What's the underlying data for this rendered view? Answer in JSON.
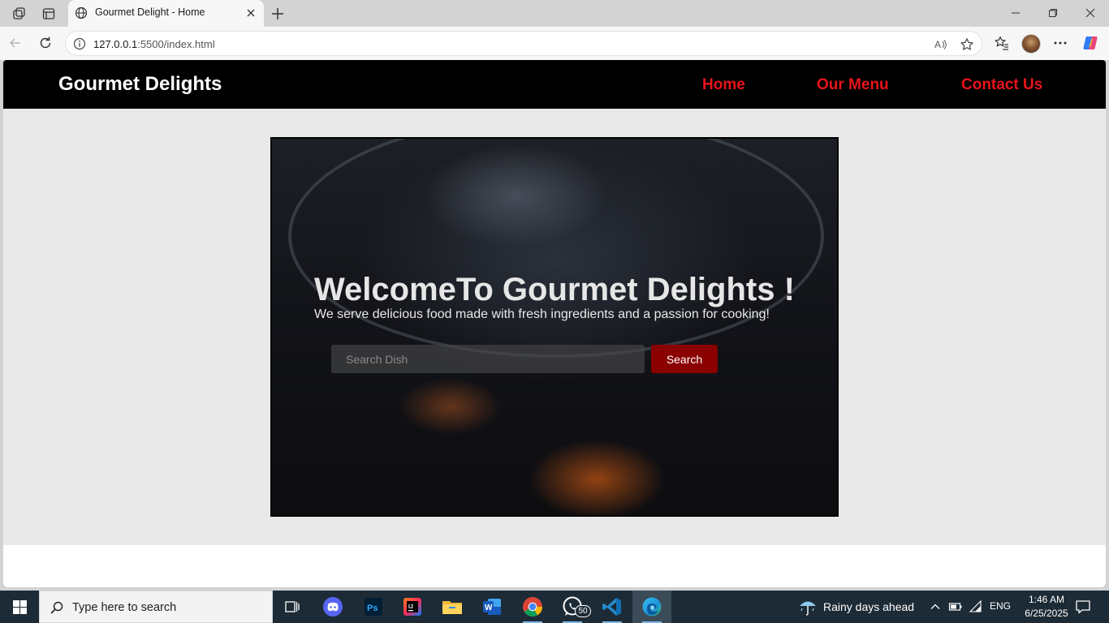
{
  "browser": {
    "tab": {
      "title": "Gourmet Delight - Home"
    },
    "address": {
      "host": "127.0.0.1",
      "rest": ":5500/index.html"
    }
  },
  "site": {
    "brand": "Gourmet Delights",
    "nav": [
      "Home",
      "Our Menu",
      "Contact Us"
    ],
    "hero": {
      "title": "WelcomeTo Gourmet Delights !",
      "subtitle": "We serve delicious food made with fresh ingredients and a passion for cooking!",
      "search_placeholder": "Search Dish",
      "search_button": "Search"
    }
  },
  "taskbar": {
    "search_placeholder": "Type here to search",
    "whatsapp_badge": "50",
    "weather": "Rainy days ahead",
    "language": "ENG",
    "time": "1:46 AM",
    "date": "6/25/2025"
  },
  "colors": {
    "nav_link": "#e8141b",
    "search_button": "#8b0000",
    "nav_bg": "#000000",
    "page_bg": "#e9e9e9"
  }
}
